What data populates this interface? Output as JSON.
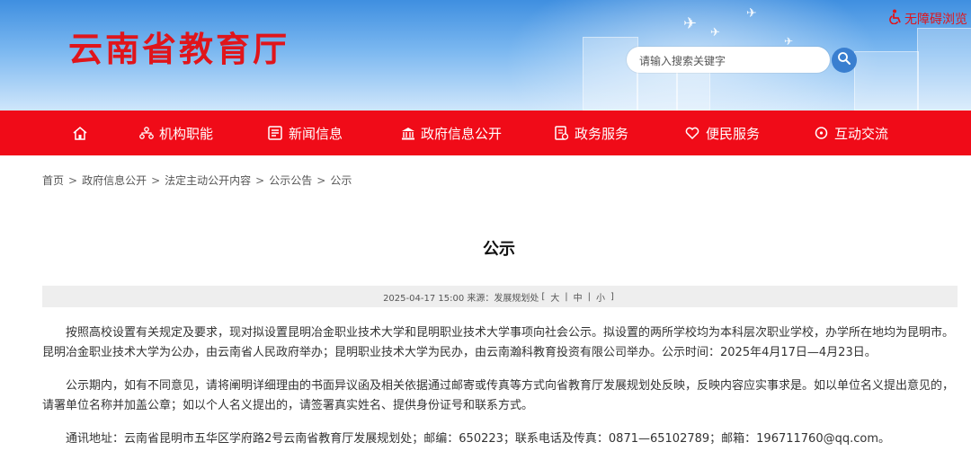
{
  "header": {
    "site_title": "云南省教育厅",
    "accessibility_label": "无障碍浏览",
    "search_placeholder": "请输入搜索关键字"
  },
  "nav": {
    "items": [
      {
        "label": "机构职能",
        "icon": "org-chart-icon"
      },
      {
        "label": "新闻信息",
        "icon": "newspaper-icon"
      },
      {
        "label": "政府信息公开",
        "icon": "government-building-icon"
      },
      {
        "label": "政务服务",
        "icon": "service-document-icon"
      },
      {
        "label": "便民服务",
        "icon": "heart-hand-icon"
      },
      {
        "label": "互动交流",
        "icon": "chat-bubble-icon"
      }
    ]
  },
  "breadcrumb": {
    "items": [
      "首页",
      "政府信息公开",
      "法定主动公开内容",
      "公示公告",
      "公示"
    ],
    "separator": ">"
  },
  "article": {
    "title": "公示",
    "meta": {
      "date_source": "2025-04-17 15:00 来源：发展规划处",
      "font_size_open": "[",
      "font_large": "大",
      "font_medium": "中",
      "font_small": "小",
      "font_size_close": "]",
      "divider": "|"
    },
    "paragraphs": [
      "按照高校设置有关规定及要求，现对拟设置昆明冶金职业技术大学和昆明职业技术大学事项向社会公示。拟设置的两所学校均为本科层次职业学校，办学所在地均为昆明市。昆明冶金职业技术大学为公办，由云南省人民政府举办；昆明职业技术大学为民办，由云南瀚科教育投资有限公司举办。公示时间：2025年4月17日—4月23日。",
      "公示期内，如有不同意见，请将阐明详细理由的书面异议函及相关依据通过邮寄或传真等方式向省教育厅发展规划处反映，反映内容应实事求是。如以单位名义提出意见的，请署单位名称并加盖公章；如以个人名义提出的，请签署真实姓名、提供身份证号和联系方式。",
      "通讯地址：云南省昆明市五华区学府路2号云南省教育厅发展规划处；邮编：650223；联系电话及传真：0871—65102789；邮箱：196711760@qq.com。"
    ]
  },
  "colors": {
    "brand_red": "#e0151b",
    "nav_red": "#f00b18",
    "sky_blue": "#3f8fe0",
    "search_blue": "#3a7fd0",
    "meta_bg": "#eeeeee"
  }
}
